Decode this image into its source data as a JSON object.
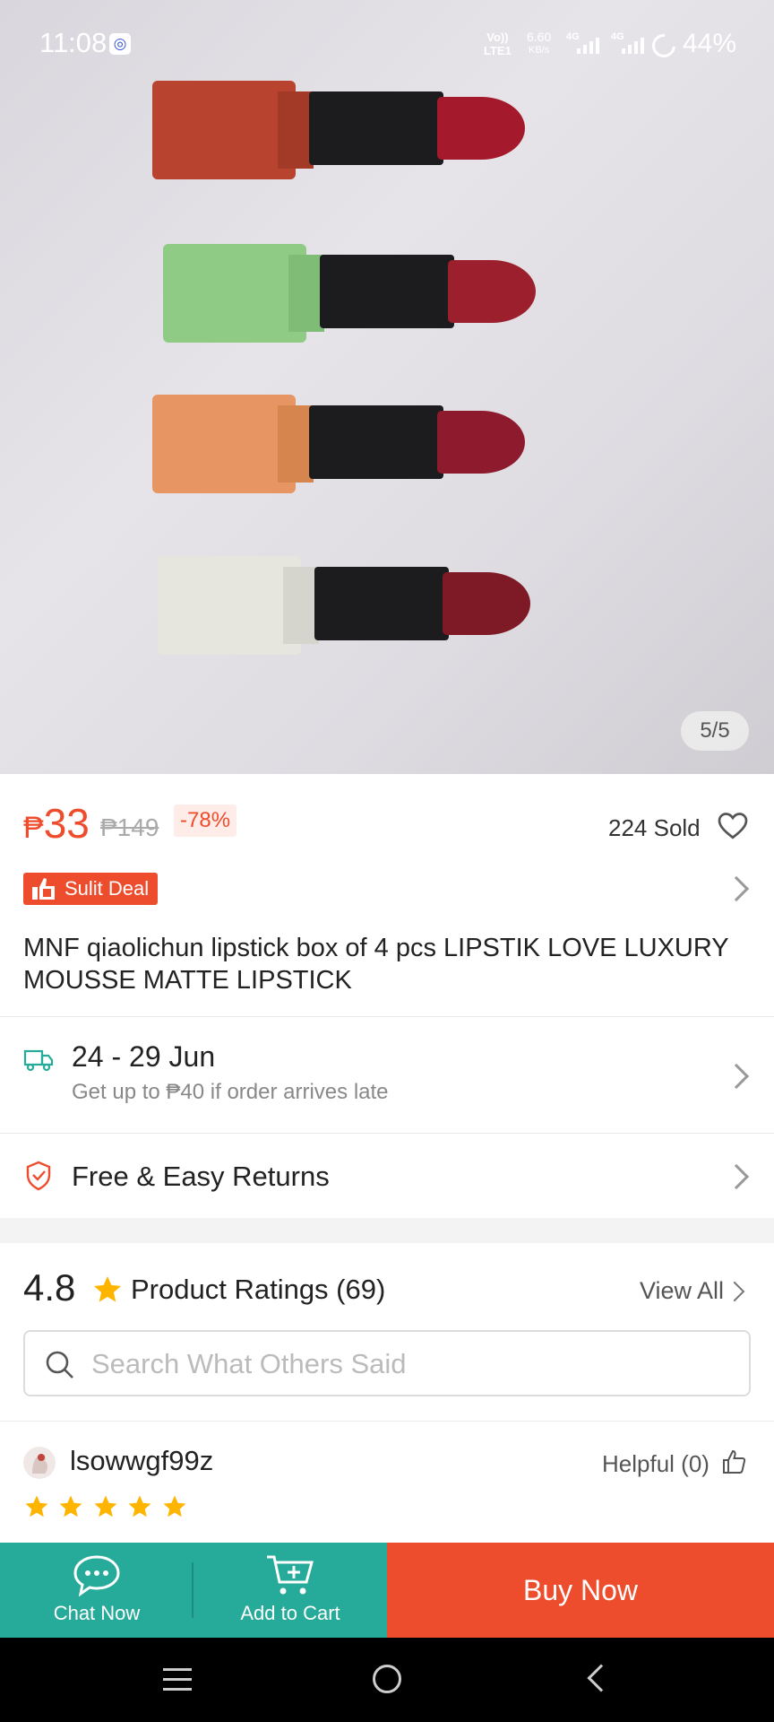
{
  "status_bar": {
    "time": "11:08",
    "network_top": "Vo))",
    "network_bottom": "LTE1",
    "speed_value": "6.60",
    "speed_unit": "KB/s",
    "signal1": "4G",
    "signal2": "4G",
    "battery": "44%"
  },
  "hero": {
    "image_counter": "5/5",
    "lipstick_colors": [
      {
        "cap": "#b8432f",
        "bullet": "#a5192c"
      },
      {
        "cap": "#8fcb85",
        "bullet": "#9b1f2d"
      },
      {
        "cap": "#e79563",
        "bullet": "#8d1a2d"
      },
      {
        "cap": "#e6e6df",
        "bullet": "#7e1a26"
      }
    ]
  },
  "product": {
    "currency": "₱",
    "price": "33",
    "original_price": "₱149",
    "discount": "-78%",
    "sold": "224 Sold",
    "deal_badge": "Sulit Deal",
    "title": "MNF qiaolichun lipstick box of 4 pcs LIPSTIK LOVE LUXURY MOUSSE MATTE LIPSTICK"
  },
  "shipping": {
    "dates": "24 - 29 Jun",
    "guarantee": "Get up to ₱40 if order arrives late"
  },
  "returns": {
    "label": "Free & Easy Returns"
  },
  "ratings": {
    "score": "4.8",
    "label": "Product Ratings (69)",
    "view_all": "View All",
    "search_placeholder": "Search What Others Said"
  },
  "review": {
    "username": "lsowwgf99z",
    "helpful": "Helpful (0)",
    "stars": 5
  },
  "actions": {
    "chat": "Chat Now",
    "cart": "Add to Cart",
    "buy": "Buy Now"
  },
  "colors": {
    "brand": "#ee4d2d",
    "teal": "#26aa99",
    "star": "#ffb400"
  }
}
